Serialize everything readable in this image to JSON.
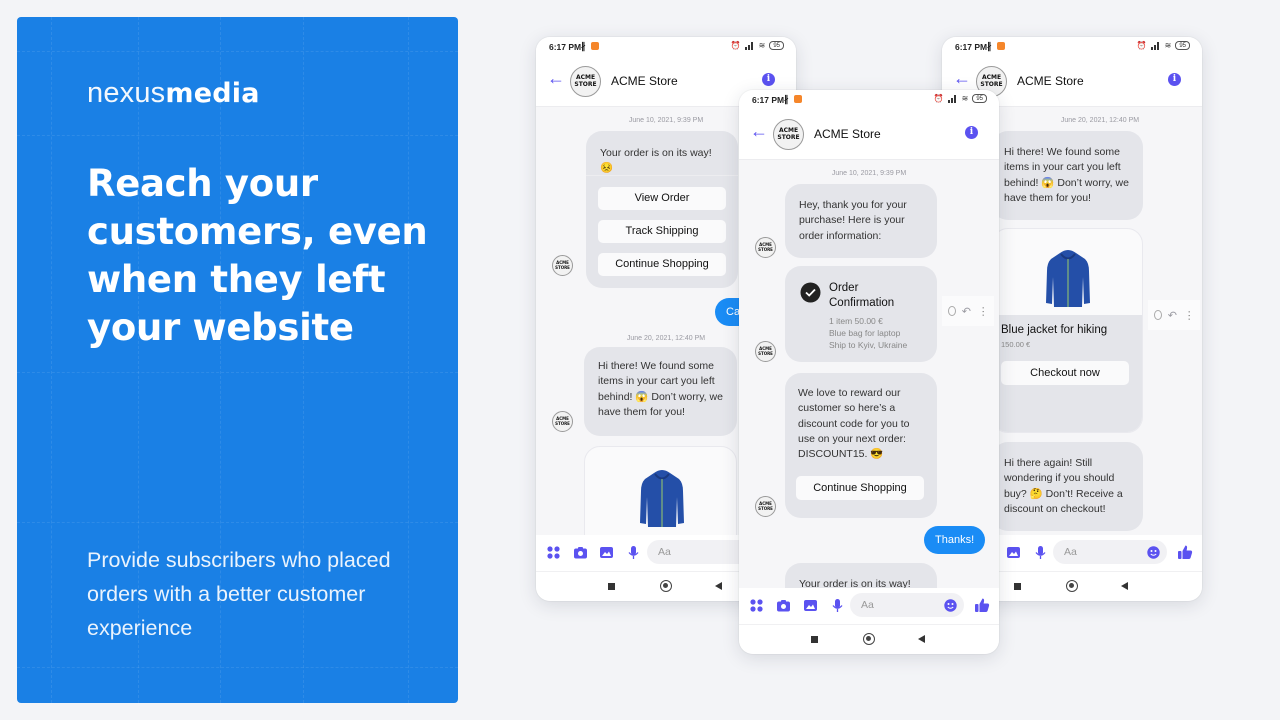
{
  "promo": {
    "logo_light": "nexus",
    "logo_bold": "media",
    "headline": "Reach your customers, even when they left your website",
    "subline": "Provide subscribers who placed orders with a better customer experience",
    "background_color": "#1a80e5"
  },
  "accent_color": "#5b52f0",
  "outgoing_bubble_color": "#1a8cf5",
  "phones": {
    "left": {
      "status": {
        "time": "6:17 PM",
        "battery": "95"
      },
      "header": {
        "title": "ACME Store",
        "avatar_line1": "ACME",
        "avatar_line2": "STORE"
      },
      "messages": {
        "ts1": "June 10, 2021, 9:39 PM",
        "order_text": "Your order is on its way!😣",
        "buttons": [
          "View Order",
          "Track Shipping",
          "Continue Shopping"
        ],
        "outgoing_partial": "Can",
        "ts2": "June 20, 2021, 12:40 PM",
        "cart_text": "Hi there! We found some items in your cart you left behind! 😱 Don’t worry, we have them for you!"
      },
      "composer_placeholder": "Aa"
    },
    "middle": {
      "status": {
        "time": "6:17 PM",
        "battery": "95"
      },
      "header": {
        "title": "ACME Store",
        "avatar_line1": "ACME",
        "avatar_line2": "STORE"
      },
      "messages": {
        "ts1": "June 10, 2021, 9:39 PM",
        "thanks_text": "Hey, thank you for your purchase! Here is your order information:",
        "order_title": "Order Confirmation",
        "order_line1": "1 item 50.00 €",
        "order_line2": "Blue bag for laptop",
        "order_line3": "Ship to Kyiv, Ukraine",
        "discount_text": "We love to reward our customer so here’s a discount code for you to use on your next order: DISCOUNT15. 😎",
        "discount_button": "Continue Shopping",
        "outgoing": "Thanks!",
        "partial_text": "Your order is on its way!"
      },
      "composer_placeholder": "Aa"
    },
    "right": {
      "status": {
        "time": "6:17 PM",
        "battery": "95"
      },
      "header": {
        "title": "ACME Store",
        "avatar_line1": "ACME",
        "avatar_line2": "STORE"
      },
      "messages": {
        "ts1": "June 20, 2021, 12:40 PM",
        "cart_text": "Hi there! We found some items in your cart you left behind! 😱 Don’t worry, we have them for you!",
        "product_name": "Blue jacket for hiking",
        "product_price": "150.00 €",
        "checkout_button": "Checkout now",
        "followup_text": "Hi there again! Still wondering if you should buy? 🤔 Don’t! Receive a discount on checkout!"
      },
      "composer_placeholder": "Aa"
    }
  }
}
